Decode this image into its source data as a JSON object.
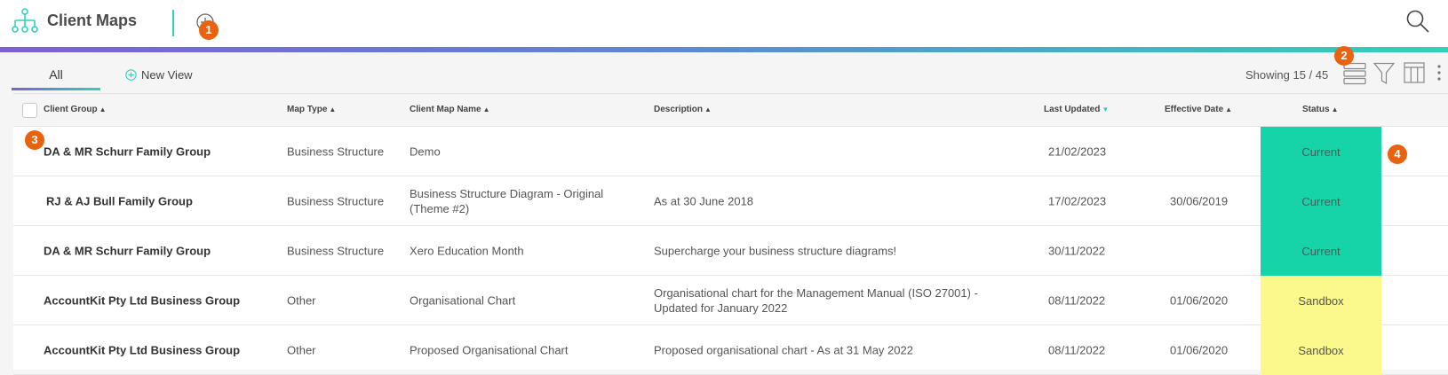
{
  "app": {
    "title": "Client Maps"
  },
  "badges": [
    "1",
    "2",
    "3",
    "4"
  ],
  "tabs": {
    "all_label": "All",
    "new_view_label": "New View"
  },
  "toolbar": {
    "showing": "Showing 15 / 45"
  },
  "columns": {
    "client_group": "Client Group",
    "map_type": "Map Type",
    "client_map_name": "Client Map Name",
    "description": "Description",
    "last_updated": "Last Updated",
    "effective_date": "Effective Date",
    "status": "Status"
  },
  "rows": [
    {
      "client_group": "DA & MR Schurr Family Group",
      "map_type": "Business Structure",
      "map_name_1": "Demo",
      "map_name_2": "",
      "description_1": "",
      "description_2": "",
      "last_updated": "21/02/2023",
      "effective_date": "",
      "status": "Current"
    },
    {
      "client_group": "RJ & AJ Bull Family Group",
      "map_type": "Business Structure",
      "map_name_1": "Business Structure Diagram - Original",
      "map_name_2": "(Theme #2)",
      "description_1": "As at 30 June 2018",
      "description_2": "",
      "last_updated": "17/02/2023",
      "effective_date": "30/06/2019",
      "status": "Current"
    },
    {
      "client_group": "DA & MR Schurr Family Group",
      "map_type": "Business Structure",
      "map_name_1": "Xero Education Month",
      "map_name_2": "",
      "description_1": "Supercharge your business structure diagrams!",
      "description_2": "",
      "last_updated": "30/11/2022",
      "effective_date": "",
      "status": "Current"
    },
    {
      "client_group": "AccountKit Pty Ltd Business Group",
      "map_type": "Other",
      "map_name_1": "Organisational Chart",
      "map_name_2": "",
      "description_1": "Organisational chart for the Management Manual (ISO 27001) -",
      "description_2": "Updated for January 2022",
      "last_updated": "08/11/2022",
      "effective_date": "01/06/2020",
      "status": "Sandbox"
    },
    {
      "client_group": "AccountKit Pty Ltd Business Group",
      "map_type": "Other",
      "map_name_1": "Proposed Organisational Chart",
      "map_name_2": "",
      "description_1": "Proposed organisational chart - As at 31 May 2022",
      "description_2": "",
      "last_updated": "08/11/2022",
      "effective_date": "01/06/2020",
      "status": "Sandbox"
    }
  ],
  "icons": {
    "logo": "hierarchy-icon",
    "add": "plus-circle-icon",
    "search": "search-icon",
    "rows": "rows-icon",
    "filter": "filter-icon",
    "columns": "columns-icon",
    "more": "more-vertical-icon"
  },
  "colors": {
    "accent": "#2fd2b8",
    "gradient_start": "#7c5fd6",
    "badge": "#e8620f",
    "status_current": "#17d4a8",
    "status_sandbox": "#fbf98c"
  }
}
